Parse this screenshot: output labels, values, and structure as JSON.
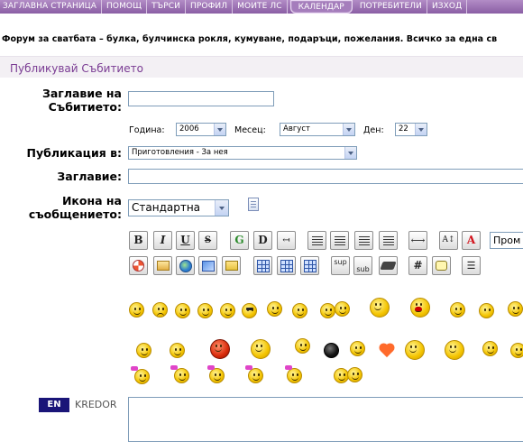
{
  "nav": {
    "items": [
      "ЗАГЛАВНА СТРАНИЦА",
      "ПОМОЩ",
      "ТЪРСИ",
      "ПРОФИЛ",
      "МОИТЕ ЛС",
      "КАЛЕНДАР",
      "ПОТРЕБИТЕЛИ",
      "ИЗХОД"
    ],
    "active": "КАЛЕНДАР"
  },
  "tagline": "Форум за сватбата – булка, булчинска рокля, кумуване, подаръци, пожелания. Всичко за една св",
  "section_title": "Публикувай Събитието",
  "form": {
    "event_title_label": "Заглавие на Събитието:",
    "year_label": "Година:",
    "year_value": "2006",
    "month_label": "Месец:",
    "month_value": "Август",
    "day_label": "Ден:",
    "day_value": "22",
    "publication_label": "Публикация в:",
    "publication_value": "Приготовления - За нея",
    "title_label": "Заглавие:",
    "icon_label": "Икона на съобщението:",
    "icon_value": "Стандартна"
  },
  "toolbar": {
    "bold": "B",
    "italic": "I",
    "underline": "U",
    "strike": "S",
    "glow": "G",
    "shadow": "D",
    "move": "↤",
    "hr": "⟷",
    "size": "A↕",
    "color": "A",
    "sup": "sup",
    "sub": "sub",
    "hash": "#",
    "list": "☰",
    "font_value": "Пром"
  },
  "colors": {
    "nav_bg": "#8a5ea4",
    "section_title": "#7a3b93",
    "lang_badge": "#1a1578"
  },
  "language": {
    "code": "EN",
    "name": "KREDOR"
  }
}
